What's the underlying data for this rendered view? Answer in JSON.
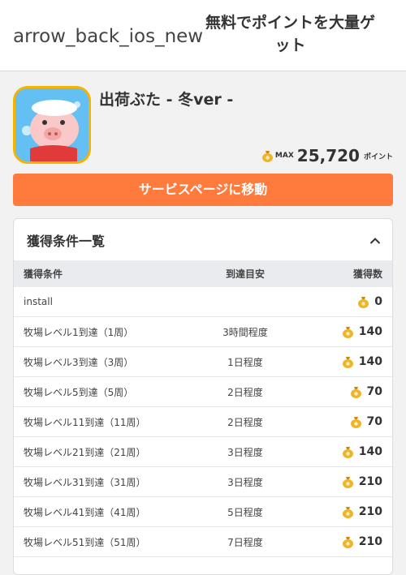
{
  "header": {
    "back": "arrow_back_ios_new",
    "title": "無料でポイントを大量ゲット"
  },
  "app": {
    "name": "出荷ぶた - 冬ver -",
    "max_label": "MAX",
    "max_points": "25,720",
    "points_unit": "ポイント"
  },
  "service_button": "サービスページに移動",
  "conditions": {
    "title": "獲得条件一覧",
    "columns": [
      "獲得条件",
      "到達目安",
      "獲得数"
    ],
    "rows": [
      {
        "condition": "install",
        "eta": "",
        "points": "0"
      },
      {
        "condition": "牧場レベル1到達（1周）",
        "eta": "3時間程度",
        "points": "140"
      },
      {
        "condition": "牧場レベル3到達（3周）",
        "eta": "1日程度",
        "points": "140"
      },
      {
        "condition": "牧場レベル5到達（5周）",
        "eta": "2日程度",
        "points": "70"
      },
      {
        "condition": "牧場レベル11到達（11周）",
        "eta": "2日程度",
        "points": "70"
      },
      {
        "condition": "牧場レベル21到達（21周）",
        "eta": "3日程度",
        "points": "140"
      },
      {
        "condition": "牧場レベル31到達（31周）",
        "eta": "3日程度",
        "points": "210"
      },
      {
        "condition": "牧場レベル41到達（41周）",
        "eta": "5日程度",
        "points": "210"
      },
      {
        "condition": "牧場レベル51到達（51周）",
        "eta": "7日程度",
        "points": "210"
      }
    ]
  },
  "icons": {
    "coin": "coin-bag-icon",
    "collapse": "chevron-up-icon"
  },
  "colors": {
    "accent": "#ff7a3d",
    "table_header": "#e9ebef",
    "coin": "#f0b429"
  }
}
